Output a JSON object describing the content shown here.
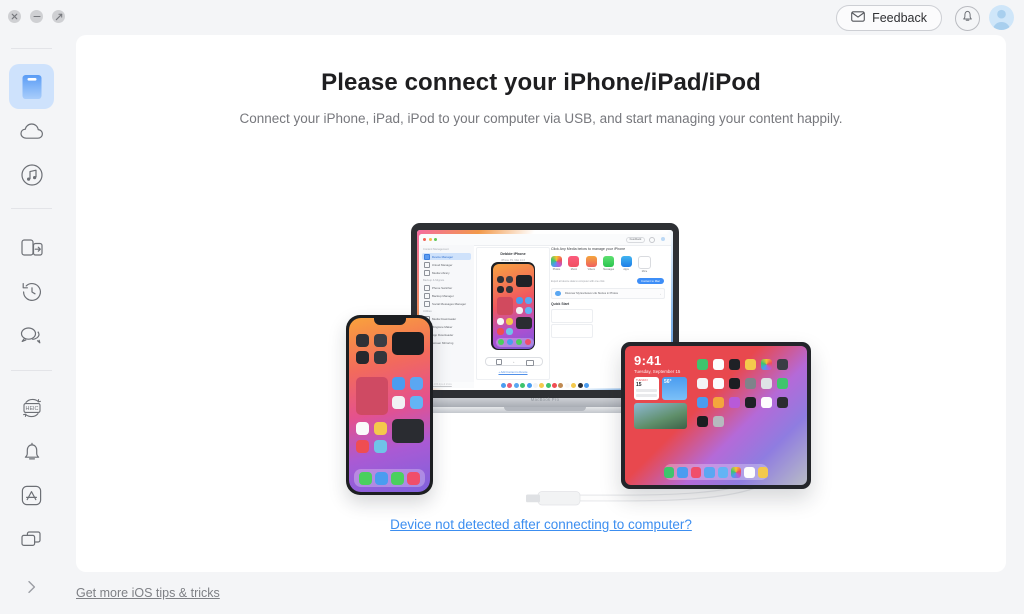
{
  "window": {
    "traffic_lights": [
      "close",
      "minimize",
      "maximize"
    ]
  },
  "topbar": {
    "feedback_label": "Feedback",
    "feedback_icon": "envelope-icon",
    "notification_icon": "bell-icon",
    "avatar_icon": "user-avatar-icon"
  },
  "sidebar": {
    "items": [
      {
        "id": "device-manager",
        "icon": "device-phone-icon",
        "active": true
      },
      {
        "id": "icloud-manager",
        "icon": "cloud-icon",
        "active": false
      },
      {
        "id": "media-library",
        "icon": "music-note-circle-icon",
        "active": false
      },
      {
        "id": "phone-switcher",
        "icon": "transfer-icon",
        "active": false
      },
      {
        "id": "backup-manager",
        "icon": "history-clock-icon",
        "active": false
      },
      {
        "id": "social-messages-manager",
        "icon": "chat-bubbles-icon",
        "active": false
      },
      {
        "id": "heic-converter",
        "icon": "heic-convert-icon",
        "active": false
      },
      {
        "id": "ringtone-maker",
        "icon": "bell-icon",
        "active": false
      },
      {
        "id": "app-downloader",
        "icon": "app-store-icon",
        "active": false
      },
      {
        "id": "screen-mirroring",
        "icon": "screens-icon",
        "active": false
      }
    ],
    "expand_icon": "chevron-right-icon",
    "expand_label": ""
  },
  "main": {
    "title": "Please connect your iPhone/iPad/iPod",
    "subtitle": "Connect your iPhone, iPad, iPod to your computer via USB, and start managing your content happily.",
    "cta_link": "Device not detected after connecting to computer?"
  },
  "footer": {
    "tips_link": "Get more iOS tips & tricks"
  },
  "illustration": {
    "macbook_label": "MacBook Pro",
    "inner_app": {
      "device_name": "Debbie·iPhone",
      "device_meta": "iPhone XS, Max 14.3",
      "device_storage": "60.5 GB of 64.0 GB Used",
      "feedback_label": "Feedback",
      "sidebar_groups": [
        {
          "title": "Content Management",
          "items": [
            "Device Manager",
            "iCloud Manager",
            "Media Library"
          ]
        },
        {
          "title": "Backup & Migrate",
          "items": [
            "Phone Switcher",
            "Backup Manager",
            "Social Messages Manager"
          ]
        },
        {
          "title": "Utilities",
          "items": [
            "Media Downloader",
            "Ringtone Maker",
            "App Downloader",
            "Screen Mirroring"
          ]
        }
      ],
      "panel_heading": "Click Any Media below to manage your iPhone",
      "media_tiles": [
        "Photos",
        "Music",
        "Videos",
        "Messages",
        "Apps",
        "More"
      ],
      "export_note": "Export all device data to computer with one click.",
      "export_button": "Content to Mac",
      "banner_text": "Discover My Exclusive Life Stories in Photos",
      "quick_start_title": "Quick Start",
      "add_content_link": "+ Add Content to Device",
      "tips_link": "Get more iOS tips & tricks"
    },
    "ipad_screen": {
      "time": "9:41",
      "date": "Tuesday, September 15",
      "widget_temp": "56°"
    },
    "cable": "lightning-cable"
  },
  "colors": {
    "page_bg": "#f4f5f7",
    "card_bg": "#ffffff",
    "accent_blue": "#3c8ef0",
    "active_nav_bg": "#cee2fc",
    "title_text": "#1e1e20",
    "muted_text": "#77787d"
  }
}
